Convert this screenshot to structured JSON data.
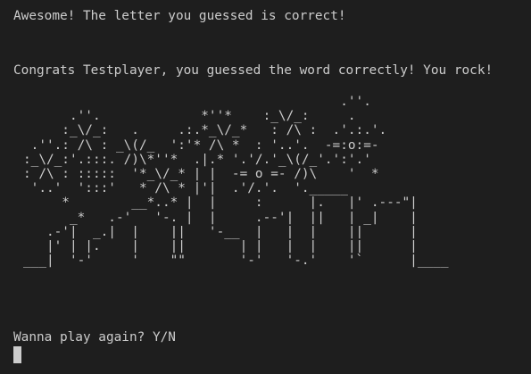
{
  "terminal": {
    "line1": "Awesome! The letter you guessed is correct!",
    "line2": "Congrats Testplayer, you guessed the word correctly! You rock!",
    "fireworks_art": "                                            .''.\n         .''.             *''*    :_\\/_:     .\n        :_\\/_:   .     .:.*_\\/_*   : /\\ :  .'.:.'.\n    .''.: /\\ : _\\(/_  ':'* /\\ *  : '..'.  -=:o:=-\n   :_\\/_:'.:::. /)\\*''*  .|.* '.'/.'_\\(/_'.':'.'\n   : /\\ : :::::  '*_\\/_* | |  -= o =- /)\\    '  *\n    '..'  ':::'   * /\\ * |'|  .'/.'.  '._____\n        *        __*..* |  |     :      |.   |' .---\"|\n         _*   .-'   '-. |  |     .--'|  ||   | _|    |\n      .-'|  _.|  |    ||   '-__  |   |  |    ||      |\n      |' | |.    |    ||       | |   |  |    ||      |\n   ___|  '-'     '    \"\"       '-'   '-.'    '`      |____",
    "prompt": "Wanna play again? Y/N"
  },
  "colors": {
    "background": "#1e1e1e",
    "text": "#cccccc"
  }
}
